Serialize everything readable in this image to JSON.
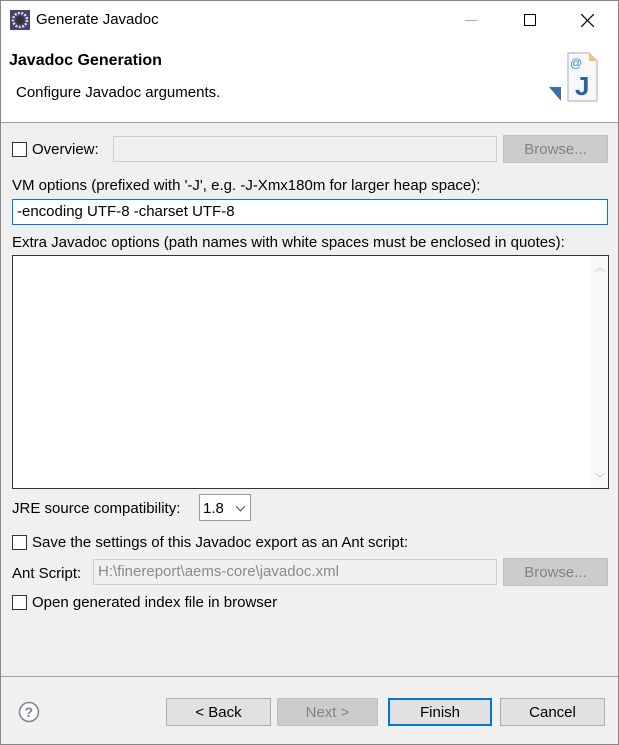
{
  "window": {
    "title": "Generate Javadoc"
  },
  "header": {
    "title": "Javadoc Generation",
    "subtitle": "Configure Javadoc arguments."
  },
  "overview": {
    "label": "Overview:",
    "value": "",
    "checked": false,
    "browse_label": "Browse..."
  },
  "vm_options": {
    "label": "VM options (prefixed with '-J', e.g. -J-Xmx180m for larger heap space):",
    "value": "-encoding UTF-8 -charset UTF-8"
  },
  "extra_options": {
    "label": "Extra Javadoc options (path names with white spaces must be enclosed in quotes):",
    "value": ""
  },
  "jre": {
    "label": "JRE source compatibility:",
    "value": "1.8"
  },
  "save_ant": {
    "label": "Save the settings of this Javadoc export as an Ant script:",
    "checked": false
  },
  "ant_script": {
    "label": "Ant Script:",
    "value": "H:\\finereport\\aems-core\\javadoc.xml",
    "browse_label": "Browse..."
  },
  "open_index": {
    "label": "Open generated index file in browser",
    "checked": false
  },
  "footer": {
    "back": "< Back",
    "next": "Next >",
    "finish": "Finish",
    "cancel": "Cancel"
  },
  "colors": {
    "accent": "#0078d7"
  }
}
